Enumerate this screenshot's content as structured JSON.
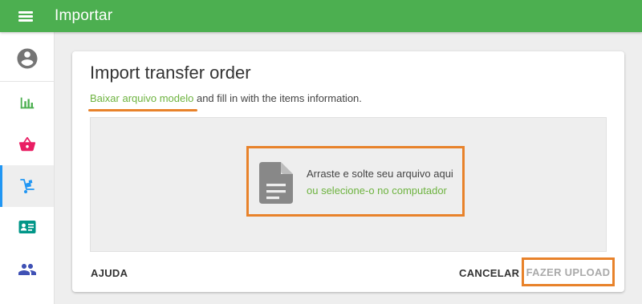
{
  "app": {
    "title": "Importar",
    "menu_icon": "hamburger-menu-icon"
  },
  "sidebar": {
    "items": [
      {
        "icon": "account-circle-icon",
        "color": "#757575"
      },
      {
        "icon": "bar-chart-icon",
        "color": "#4caf50"
      },
      {
        "icon": "shopping-basket-icon",
        "color": "#e91e63"
      },
      {
        "icon": "hand-truck-icon",
        "color": "#2196f3",
        "active": true
      },
      {
        "icon": "contact-card-icon",
        "color": "#009688"
      },
      {
        "icon": "people-icon",
        "color": "#3f51b5"
      }
    ]
  },
  "dialog": {
    "title": "Import transfer order",
    "download_link": "Baixar arquivo modelo",
    "subtitle_rest": " and fill in with the items information.",
    "dropzone": {
      "icon": "document-file-icon",
      "line1": "Arraste e solte seu arquivo aqui",
      "line2": "ou selecione-o no computador"
    },
    "buttons": {
      "help": "AJUDA",
      "cancel": "CANCELAR",
      "upload": "FAZER UPLOAD"
    }
  },
  "colors": {
    "header": "#4caf50",
    "link": "#6db33f",
    "highlight": "#e8822a",
    "active_indicator": "#2196f3"
  }
}
